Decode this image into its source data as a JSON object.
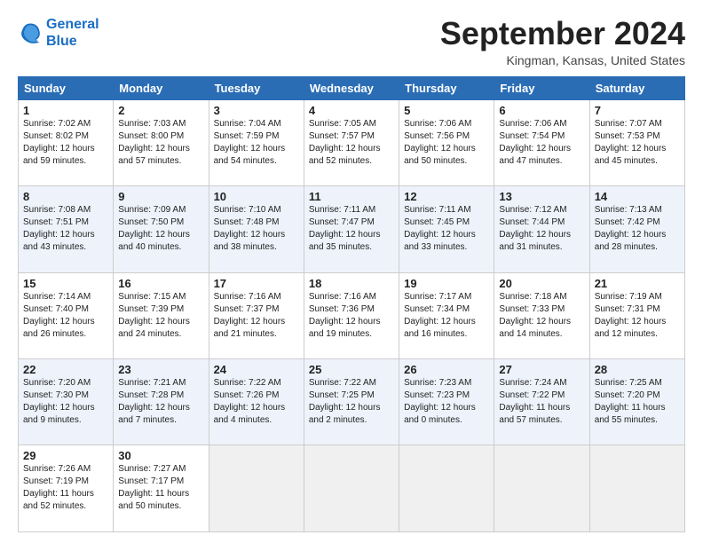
{
  "header": {
    "logo_line1": "General",
    "logo_line2": "Blue",
    "month": "September 2024",
    "location": "Kingman, Kansas, United States"
  },
  "weekdays": [
    "Sunday",
    "Monday",
    "Tuesday",
    "Wednesday",
    "Thursday",
    "Friday",
    "Saturday"
  ],
  "weeks": [
    [
      {
        "day": "1",
        "sunrise": "7:02 AM",
        "sunset": "8:02 PM",
        "daylight": "12 hours and 59 minutes."
      },
      {
        "day": "2",
        "sunrise": "7:03 AM",
        "sunset": "8:00 PM",
        "daylight": "12 hours and 57 minutes."
      },
      {
        "day": "3",
        "sunrise": "7:04 AM",
        "sunset": "7:59 PM",
        "daylight": "12 hours and 54 minutes."
      },
      {
        "day": "4",
        "sunrise": "7:05 AM",
        "sunset": "7:57 PM",
        "daylight": "12 hours and 52 minutes."
      },
      {
        "day": "5",
        "sunrise": "7:06 AM",
        "sunset": "7:56 PM",
        "daylight": "12 hours and 50 minutes."
      },
      {
        "day": "6",
        "sunrise": "7:06 AM",
        "sunset": "7:54 PM",
        "daylight": "12 hours and 47 minutes."
      },
      {
        "day": "7",
        "sunrise": "7:07 AM",
        "sunset": "7:53 PM",
        "daylight": "12 hours and 45 minutes."
      }
    ],
    [
      {
        "day": "8",
        "sunrise": "7:08 AM",
        "sunset": "7:51 PM",
        "daylight": "12 hours and 43 minutes."
      },
      {
        "day": "9",
        "sunrise": "7:09 AM",
        "sunset": "7:50 PM",
        "daylight": "12 hours and 40 minutes."
      },
      {
        "day": "10",
        "sunrise": "7:10 AM",
        "sunset": "7:48 PM",
        "daylight": "12 hours and 38 minutes."
      },
      {
        "day": "11",
        "sunrise": "7:11 AM",
        "sunset": "7:47 PM",
        "daylight": "12 hours and 35 minutes."
      },
      {
        "day": "12",
        "sunrise": "7:11 AM",
        "sunset": "7:45 PM",
        "daylight": "12 hours and 33 minutes."
      },
      {
        "day": "13",
        "sunrise": "7:12 AM",
        "sunset": "7:44 PM",
        "daylight": "12 hours and 31 minutes."
      },
      {
        "day": "14",
        "sunrise": "7:13 AM",
        "sunset": "7:42 PM",
        "daylight": "12 hours and 28 minutes."
      }
    ],
    [
      {
        "day": "15",
        "sunrise": "7:14 AM",
        "sunset": "7:40 PM",
        "daylight": "12 hours and 26 minutes."
      },
      {
        "day": "16",
        "sunrise": "7:15 AM",
        "sunset": "7:39 PM",
        "daylight": "12 hours and 24 minutes."
      },
      {
        "day": "17",
        "sunrise": "7:16 AM",
        "sunset": "7:37 PM",
        "daylight": "12 hours and 21 minutes."
      },
      {
        "day": "18",
        "sunrise": "7:16 AM",
        "sunset": "7:36 PM",
        "daylight": "12 hours and 19 minutes."
      },
      {
        "day": "19",
        "sunrise": "7:17 AM",
        "sunset": "7:34 PM",
        "daylight": "12 hours and 16 minutes."
      },
      {
        "day": "20",
        "sunrise": "7:18 AM",
        "sunset": "7:33 PM",
        "daylight": "12 hours and 14 minutes."
      },
      {
        "day": "21",
        "sunrise": "7:19 AM",
        "sunset": "7:31 PM",
        "daylight": "12 hours and 12 minutes."
      }
    ],
    [
      {
        "day": "22",
        "sunrise": "7:20 AM",
        "sunset": "7:30 PM",
        "daylight": "12 hours and 9 minutes."
      },
      {
        "day": "23",
        "sunrise": "7:21 AM",
        "sunset": "7:28 PM",
        "daylight": "12 hours and 7 minutes."
      },
      {
        "day": "24",
        "sunrise": "7:22 AM",
        "sunset": "7:26 PM",
        "daylight": "12 hours and 4 minutes."
      },
      {
        "day": "25",
        "sunrise": "7:22 AM",
        "sunset": "7:25 PM",
        "daylight": "12 hours and 2 minutes."
      },
      {
        "day": "26",
        "sunrise": "7:23 AM",
        "sunset": "7:23 PM",
        "daylight": "12 hours and 0 minutes."
      },
      {
        "day": "27",
        "sunrise": "7:24 AM",
        "sunset": "7:22 PM",
        "daylight": "11 hours and 57 minutes."
      },
      {
        "day": "28",
        "sunrise": "7:25 AM",
        "sunset": "7:20 PM",
        "daylight": "11 hours and 55 minutes."
      }
    ],
    [
      {
        "day": "29",
        "sunrise": "7:26 AM",
        "sunset": "7:19 PM",
        "daylight": "11 hours and 52 minutes."
      },
      {
        "day": "30",
        "sunrise": "7:27 AM",
        "sunset": "7:17 PM",
        "daylight": "11 hours and 50 minutes."
      },
      null,
      null,
      null,
      null,
      null
    ]
  ]
}
